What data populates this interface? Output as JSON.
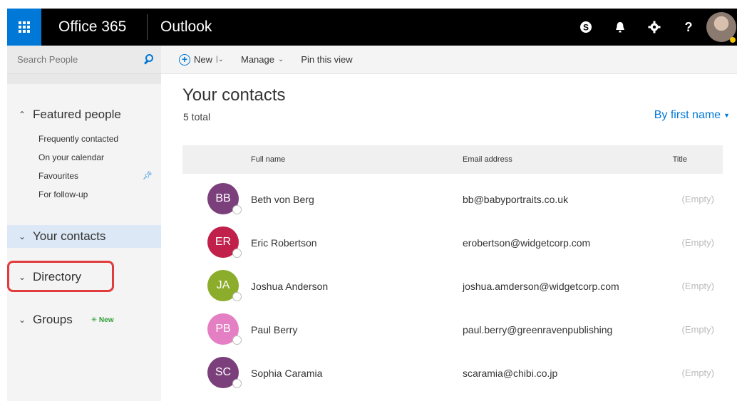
{
  "suite": {
    "brand": "Office 365",
    "app": "Outlook"
  },
  "topbar_icons": [
    "skype-icon",
    "bell-icon",
    "gear-icon",
    "help-icon",
    "user-avatar"
  ],
  "colors": {
    "accent": "#0078d7",
    "topbar": "#000000",
    "highlight": "#e03c3c",
    "new_badge": "#2e9e35"
  },
  "search": {
    "placeholder": "Search People"
  },
  "sidebar": {
    "featured": "Featured people",
    "featured_items": [
      "Frequently contacted",
      "On your calendar",
      "Favourites",
      "For follow-up"
    ],
    "your_contacts": "Your contacts",
    "directory": "Directory",
    "groups": "Groups",
    "groups_badge": "New"
  },
  "toolbar": {
    "new": "New",
    "manage": "Manage",
    "pin": "Pin this view"
  },
  "main": {
    "heading": "Your contacts",
    "total": "5 total",
    "sort": "By first name",
    "columns": {
      "name": "Full name",
      "email": "Email address",
      "title": "Title"
    }
  },
  "contacts": [
    {
      "initials": "BB",
      "name": "Beth von Berg",
      "email": "bb@babyportraits.co.uk",
      "title": "(Empty)",
      "color": "#7b3f7b"
    },
    {
      "initials": "ER",
      "name": "Eric Robertson",
      "email": "erobertson@widgetcorp.com",
      "title": "(Empty)",
      "color": "#c0204a"
    },
    {
      "initials": "JA",
      "name": "Joshua Anderson",
      "email": "joshua.amderson@widgetcorp.com",
      "title": "(Empty)",
      "color": "#8cac2c"
    },
    {
      "initials": "PB",
      "name": "Paul Berry",
      "email": "paul.berry@greenravenpublishing",
      "title": "(Empty)",
      "color": "#e57fc3"
    },
    {
      "initials": "SC",
      "name": "Sophia Caramia",
      "email": "scaramia@chibi.co.jp",
      "title": "(Empty)",
      "color": "#7b3f7b"
    }
  ]
}
